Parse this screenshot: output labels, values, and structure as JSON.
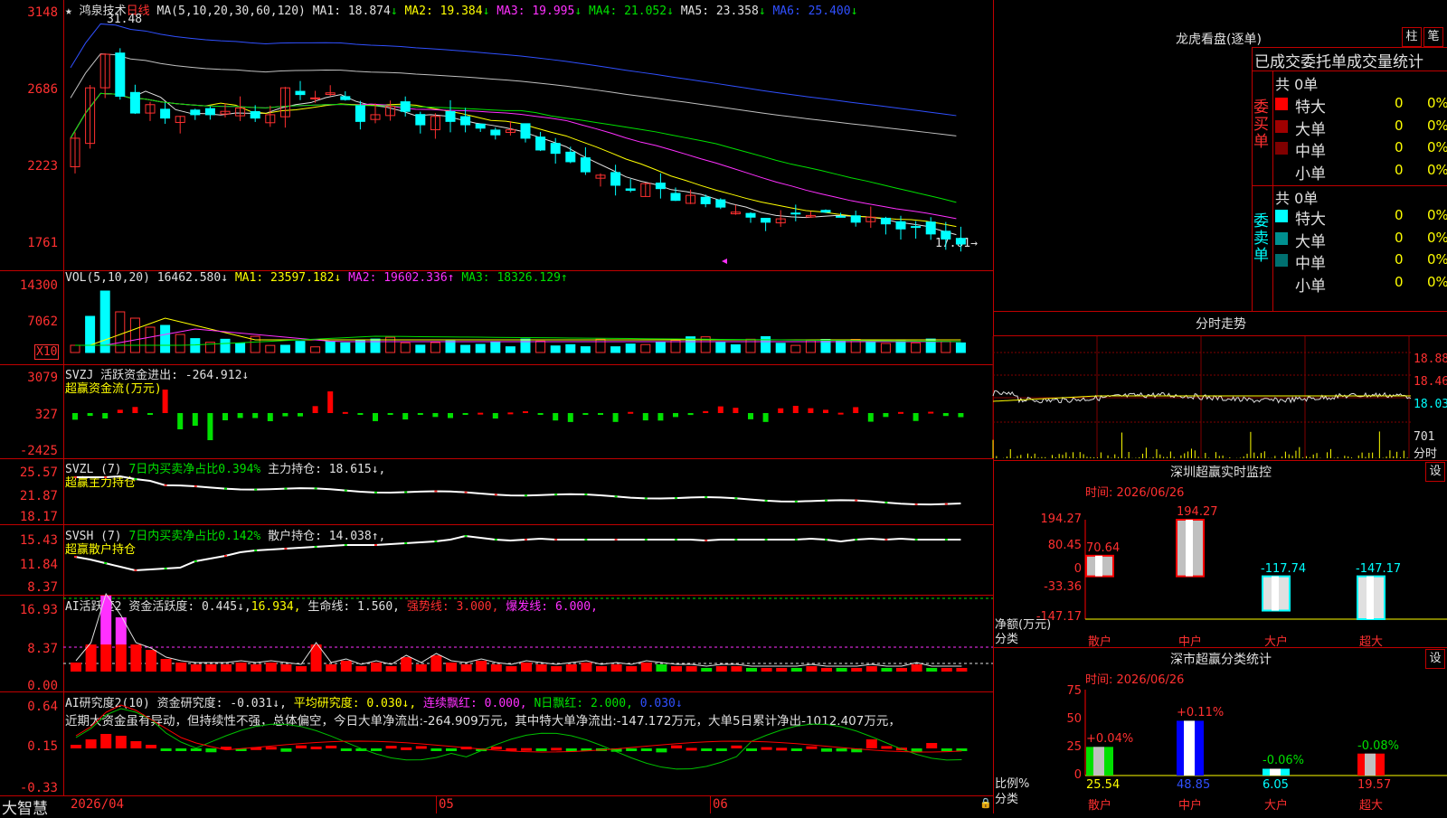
{
  "stock": {
    "name": "鸿泉技术",
    "period": "日线"
  },
  "main_panel": {
    "ma_header": "MA(5,10,20,30,60,120)",
    "ma_values": [
      {
        "label": "MA1: 18.874",
        "arrow": "↓",
        "color": "#e0e0e0"
      },
      {
        "label": "MA2: 19.384",
        "arrow": "↓",
        "color": "#ffff00"
      },
      {
        "label": "MA3: 19.995",
        "arrow": "↓",
        "color": "#ff30ff"
      },
      {
        "label": "MA4: 21.052",
        "arrow": "↓",
        "color": "#00e000"
      },
      {
        "label": "MA5: 23.358",
        "arrow": "↓",
        "color": "#e0e0e0"
      },
      {
        "label": "MA6: 25.400",
        "arrow": "↓",
        "color": "#3050ff"
      }
    ],
    "y_labels": [
      "3148",
      "2686",
      "2223",
      "1761"
    ],
    "high_label": "31.48",
    "low_label": "17.61→"
  },
  "vol_panel": {
    "header": "VOL(5,10,20)",
    "value": "16462.580↓",
    "ma1": "MA1: 23597.182↓",
    "ma2": "MA2: 19602.336↑",
    "ma3": "MA3: 18326.129↑",
    "y_labels": [
      "14300",
      "7062"
    ],
    "unit": "X10"
  },
  "svzj_panel": {
    "header": "SVZJ",
    "desc": "活跃资金进出: -264.912↓",
    "sub": "超赢资金流(万元)",
    "y_labels": [
      "3079",
      "327",
      "-2425"
    ]
  },
  "svzl_panel": {
    "header": "SVZL (7)",
    "desc": "7日内买卖净占比0.394%",
    "desc2": "主力持仓: 18.615↓,",
    "sub": "超赢主力持仓",
    "y_labels": [
      "25.57",
      "21.87",
      "18.17"
    ]
  },
  "svsh_panel": {
    "header": "SVSH (7)",
    "desc": "7日内买卖净占比0.142%",
    "desc2": "散户持仓: 14.038↑,",
    "sub": "超赢散户持仓",
    "y_labels": [
      "15.43",
      "11.84",
      "8.37"
    ]
  },
  "ai_active_panel": {
    "header": "AI活跃度2",
    "desc": "资金活跃度: 0.445↓,",
    "v2": "16.934,",
    "v3": "生命线: 1.560,",
    "v4": "强势线: 3.000,",
    "v5": "爆发线: 6.000,",
    "y_labels": [
      "16.93",
      "8.37",
      "0.00"
    ]
  },
  "ai_research_panel": {
    "header": "AI研究度2(10)",
    "desc": "资金研究度: -0.031↓,",
    "v2": "平均研究度: 0.030↓,",
    "v3": "连续飘红: 0.000,",
    "v4": "N日飘红: 2.000,",
    "v5": "0.030↓",
    "y_labels": [
      "0.64",
      "0.15",
      "-0.33"
    ],
    "comment": "近期大资金虽有异动，但持续性不强，总体偏空，今日大单净流出:-264.909万元，其中特大单净流出:-147.172万元，大单5日累计净出-1012.407万元，"
  },
  "date_axis": {
    "brand": "大智慧",
    "labels": [
      "2026/04",
      "05",
      "06"
    ]
  },
  "lhb": {
    "title": "龙虎看盘(逐单)",
    "btn1": "柱",
    "btn2": "笔",
    "header": "已成交委托单成交量统计",
    "buy": {
      "side_label": "委买单",
      "total": "共 0单",
      "rows": [
        {
          "name": "特大",
          "count": "0",
          "pct": "0%",
          "color": "#ff0000"
        },
        {
          "name": "大单",
          "count": "0",
          "pct": "0%",
          "color": "#a00000"
        },
        {
          "name": "中单",
          "count": "0",
          "pct": "0%",
          "color": "#800000"
        },
        {
          "name": "小单",
          "count": "0",
          "pct": "0%",
          "color": "#000000"
        }
      ]
    },
    "sell": {
      "side_label": "委卖单",
      "total": "共 0单",
      "rows": [
        {
          "name": "特大",
          "count": "0",
          "pct": "0%",
          "color": "#00ffff"
        },
        {
          "name": "大单",
          "count": "0",
          "pct": "0%",
          "color": "#009090"
        },
        {
          "name": "中单",
          "count": "0",
          "pct": "0%",
          "color": "#007070"
        },
        {
          "name": "小单",
          "count": "0",
          "pct": "0%",
          "color": "#000000"
        }
      ]
    }
  },
  "intraday": {
    "title": "分时走势",
    "y_labels": [
      "18.88",
      "18.46",
      "18.03",
      "701"
    ],
    "corner": "分时"
  },
  "monitor": {
    "title": "深圳超赢实时监控",
    "btn": "设",
    "time": "时间: 2026/06/26",
    "y_labels": [
      "194.27",
      "80.45",
      "0",
      "-33.36",
      "-147.17"
    ],
    "ylabel": "净额(万元)",
    "xlabel": "分类",
    "chart_data": {
      "type": "bar",
      "categories": [
        "散户",
        "中户",
        "大户",
        "超大"
      ],
      "values": [
        70.64,
        194.27,
        -117.74,
        -147.17
      ],
      "ylim": [
        -147.17,
        194.27
      ]
    },
    "value_labels": [
      "70.64",
      "194.27",
      "-117.74",
      "-147.17"
    ]
  },
  "classify": {
    "title": "深市超赢分类统计",
    "btn": "设",
    "time": "时间: 2026/06/26",
    "y_labels": [
      "75",
      "50",
      "25",
      "0"
    ],
    "ylabel": "比例%",
    "xlabel": "分类",
    "chart_data": {
      "type": "bar",
      "categories": [
        "散户",
        "中户",
        "大户",
        "超大"
      ],
      "values": [
        25.54,
        48.85,
        6.05,
        19.57
      ],
      "changes": [
        "+0.04%",
        "+0.11%",
        "-0.06%",
        "-0.08%"
      ],
      "ylim": [
        0,
        75
      ]
    },
    "value_labels": [
      "25.54",
      "48.85",
      "6.05",
      "19.57"
    ]
  }
}
